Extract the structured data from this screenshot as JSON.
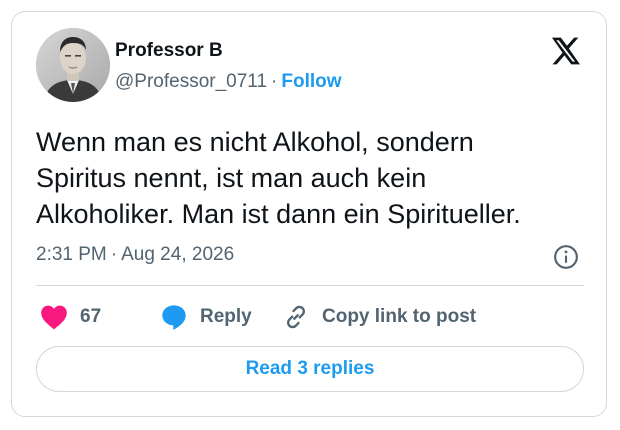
{
  "author": {
    "name": "Professor B",
    "handle": "@Professor_0711",
    "separator": "·",
    "follow_label": "Follow"
  },
  "tweet": {
    "lines": [
      "Wenn man es nicht Alkohol, sondern",
      "Spiritus nennt, ist man auch kein",
      "Alkoholiker. Man ist dann ein Spiritueller."
    ],
    "time": "2:31 PM",
    "date": "Aug 24, 2026"
  },
  "actions": {
    "like_count": "67",
    "reply_label": "Reply",
    "copy_label": "Copy link to post"
  },
  "footer": {
    "read_replies_label": "Read 3 replies"
  },
  "icons": {
    "like": "heart-icon",
    "reply": "speech-bubble-icon",
    "copy": "link-icon",
    "info": "info-icon",
    "brand": "x-logo-icon"
  },
  "colors": {
    "accent": "#1d9bf0",
    "like": "#f91880",
    "text": "#0f1419",
    "secondary": "#536471",
    "border": "#cfd9de"
  }
}
